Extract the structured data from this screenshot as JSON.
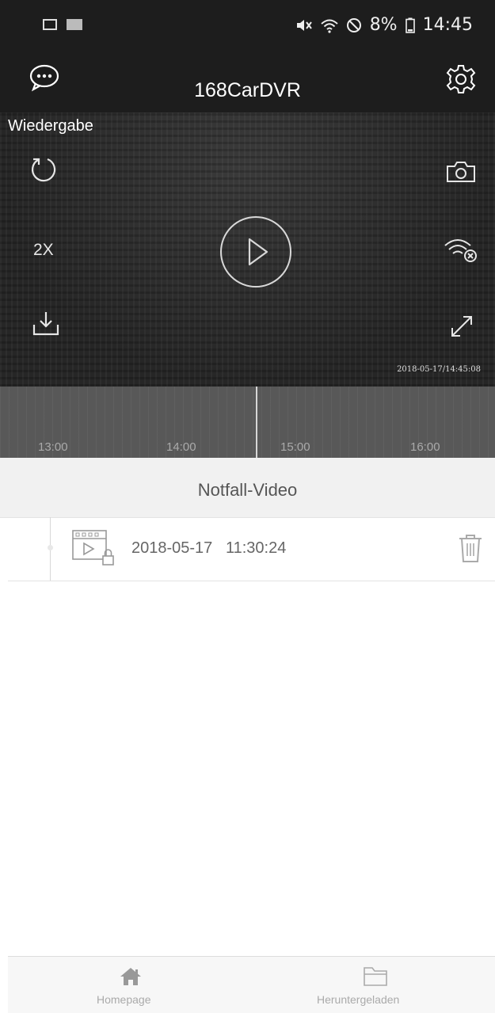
{
  "status_bar": {
    "battery": "8%",
    "time": "14:45"
  },
  "app_bar": {
    "title": "168CarDVR"
  },
  "player": {
    "label": "Wiedergabe",
    "speed": "2X",
    "timestamp": "2018-05-17/14:45:08"
  },
  "timeline": {
    "ticks": [
      "13:00",
      "14:00",
      "15:00",
      "16:00"
    ]
  },
  "section": {
    "title": "Notfall-Video"
  },
  "video_list": [
    {
      "date": "2018-05-17",
      "time": "11:30:24"
    }
  ],
  "bottom_nav": [
    {
      "label": "Homepage",
      "icon": "home-icon"
    },
    {
      "label": "Heruntergeladen",
      "icon": "folder-icon"
    }
  ]
}
